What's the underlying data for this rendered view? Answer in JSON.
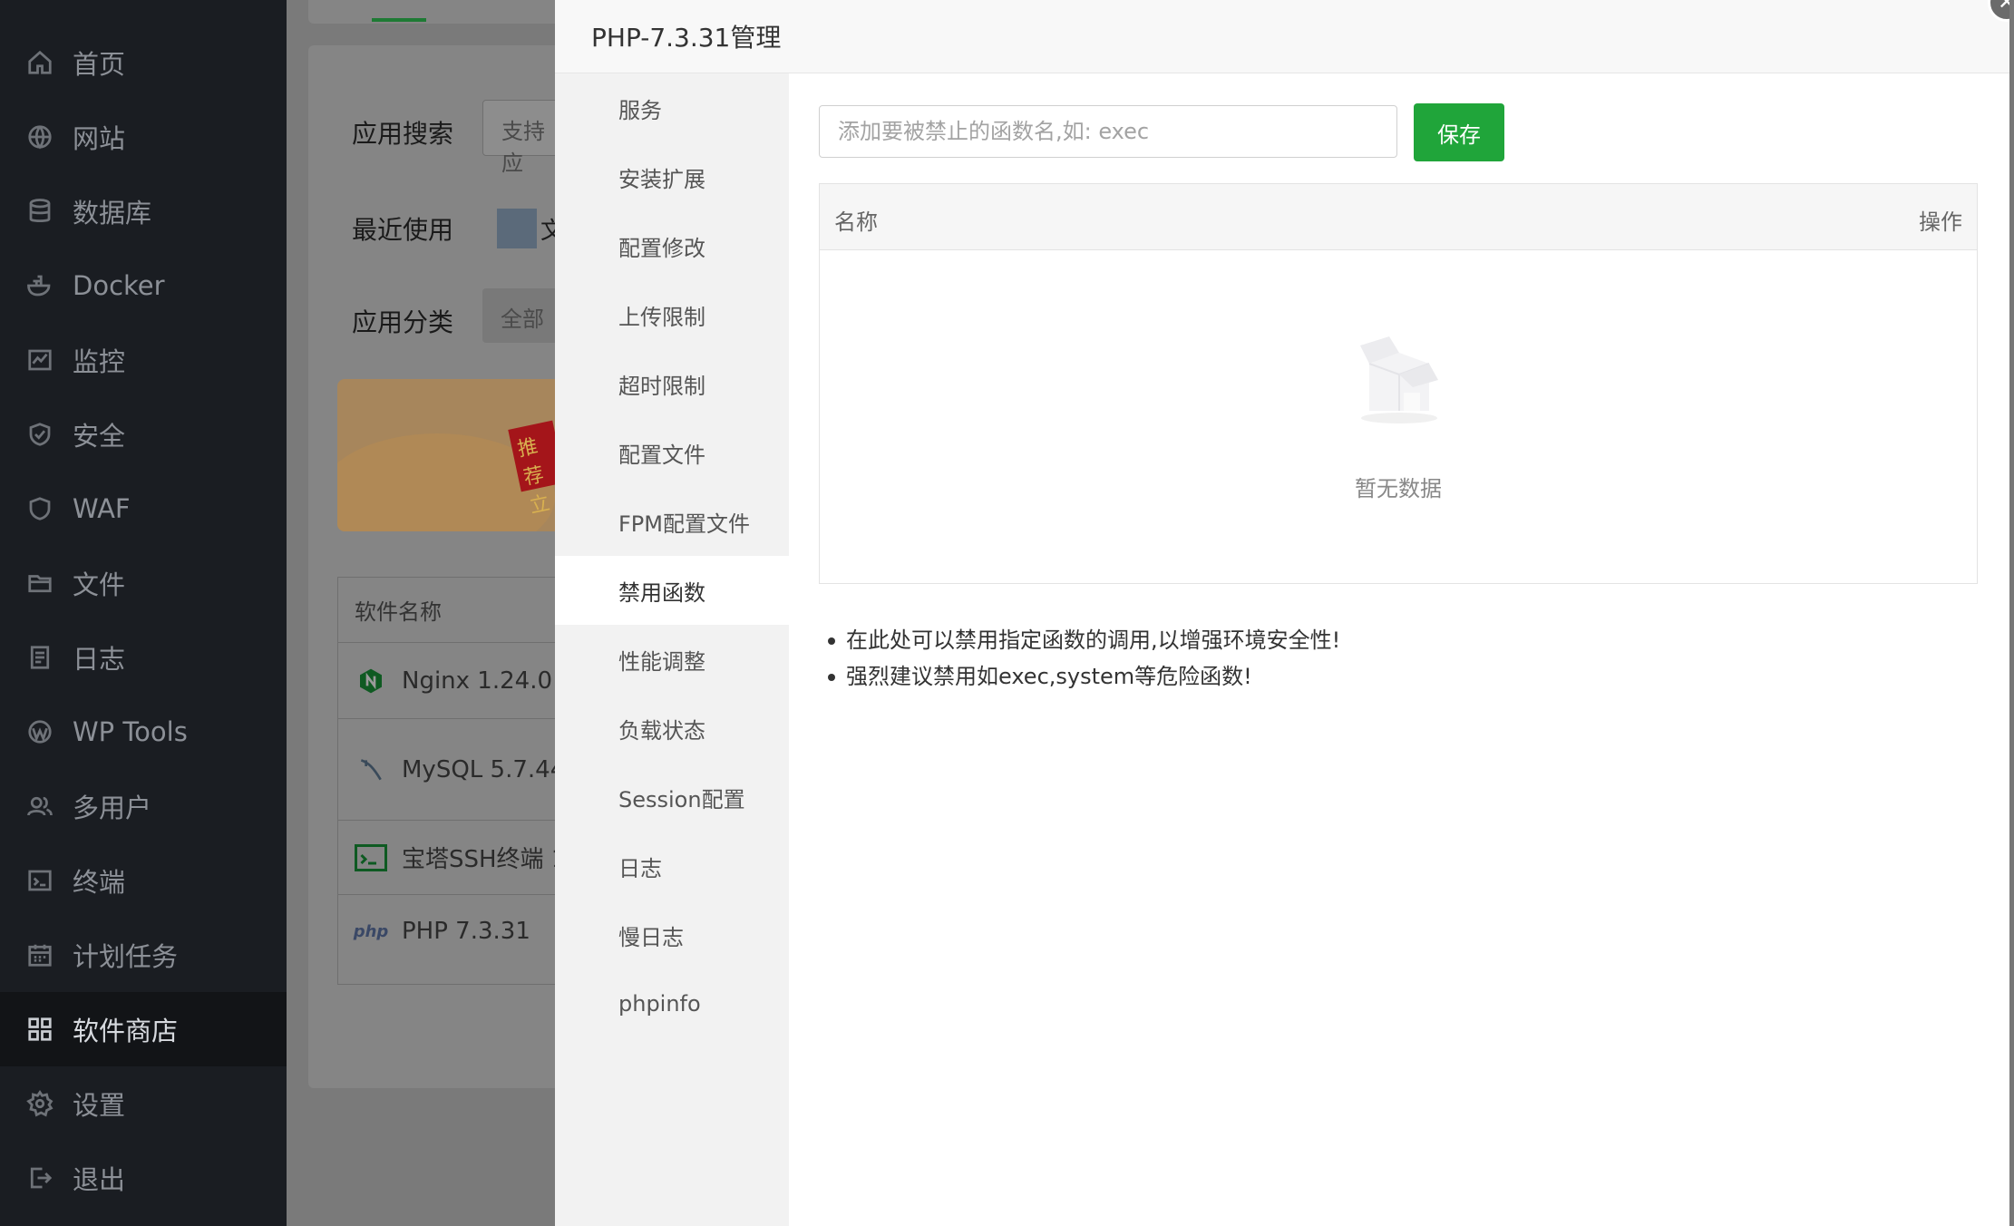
{
  "sidebar": {
    "items": [
      {
        "label": "首页",
        "icon": "home-icon"
      },
      {
        "label": "网站",
        "icon": "globe-icon"
      },
      {
        "label": "数据库",
        "icon": "database-icon"
      },
      {
        "label": "Docker",
        "icon": "docker-icon"
      },
      {
        "label": "监控",
        "icon": "monitor-icon"
      },
      {
        "label": "安全",
        "icon": "shield-icon"
      },
      {
        "label": "WAF",
        "icon": "waf-shield-icon"
      },
      {
        "label": "文件",
        "icon": "folder-icon"
      },
      {
        "label": "日志",
        "icon": "log-icon"
      },
      {
        "label": "WP Tools",
        "icon": "wordpress-icon"
      },
      {
        "label": "多用户",
        "icon": "users-icon"
      },
      {
        "label": "终端",
        "icon": "terminal-icon"
      },
      {
        "label": "计划任务",
        "icon": "calendar-icon"
      },
      {
        "label": "软件商店",
        "icon": "grid-icon"
      },
      {
        "label": "设置",
        "icon": "gear-icon"
      },
      {
        "label": "退出",
        "icon": "logout-icon"
      }
    ],
    "active_index": 13
  },
  "background": {
    "search_label": "应用搜索",
    "search_placeholder": "支持应",
    "recent_label": "最近使用",
    "recent_item": "文",
    "category_label": "应用分类",
    "category_selected": "全部",
    "banner_tag": "推荐",
    "banner_text": "立",
    "table_header": "软件名称",
    "table_rows": [
      "Nginx 1.24.0",
      "MySQL 5.7.44",
      "宝塔SSH终端 1",
      "PHP 7.3.31"
    ]
  },
  "modal": {
    "title": "PHP-7.3.31管理",
    "close_symbol": "✕",
    "nav": [
      "服务",
      "安装扩展",
      "配置修改",
      "上传限制",
      "超时限制",
      "配置文件",
      "FPM配置文件",
      "禁用函数",
      "性能调整",
      "负载状态",
      "Session配置",
      "日志",
      "慢日志",
      "phpinfo"
    ],
    "nav_active_index": 7,
    "input_placeholder": "添加要被禁止的函数名,如: exec",
    "save_label": "保存",
    "table": {
      "col_name": "名称",
      "col_op": "操作",
      "empty_text": "暂无数据"
    },
    "tips": [
      "在此处可以禁用指定函数的调用,以增强环境安全性!",
      "强烈建议禁用如exec,system等危险函数!"
    ]
  },
  "colors": {
    "accent": "#20a53a",
    "sidebar_bg": "#1a1d22"
  }
}
